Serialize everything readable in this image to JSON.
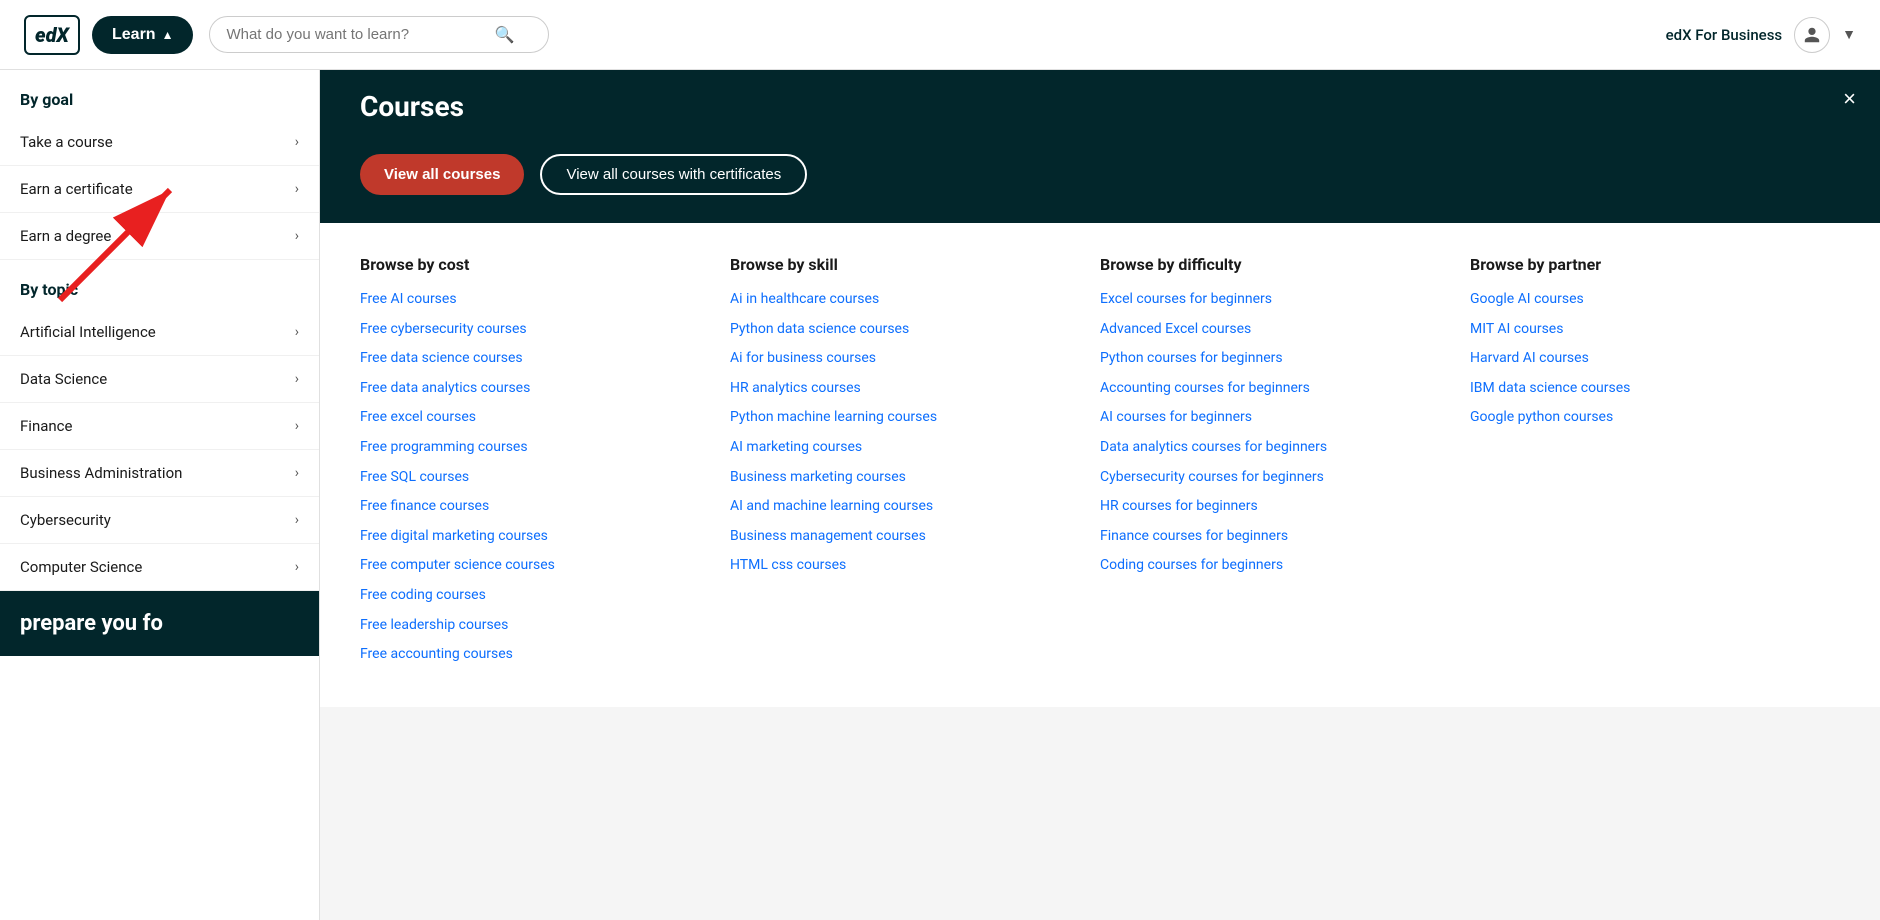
{
  "header": {
    "logo": "edX",
    "learn_button": "Learn",
    "search_placeholder": "What do you want to learn?",
    "for_business": "edX For Business"
  },
  "sidebar": {
    "by_goal_title": "By goal",
    "by_topic_title": "By topic",
    "goal_items": [
      {
        "label": "Take a course"
      },
      {
        "label": "Earn a certificate"
      },
      {
        "label": "Earn a degree"
      }
    ],
    "topic_items": [
      {
        "label": "Artificial Intelligence"
      },
      {
        "label": "Data Science"
      },
      {
        "label": "Finance"
      },
      {
        "label": "Business Administration"
      },
      {
        "label": "Cybersecurity"
      },
      {
        "label": "Computer Science"
      }
    ],
    "bottom_banner": "prepare you fo"
  },
  "dropdown": {
    "title": "Courses",
    "btn_primary": "View all courses",
    "btn_outline": "View all courses with certificates",
    "close_label": "×"
  },
  "browse": {
    "columns": [
      {
        "title": "Browse by cost",
        "links": [
          "Free AI courses",
          "Free cybersecurity courses",
          "Free data science courses",
          "Free data analytics courses",
          "Free excel courses",
          "Free programming courses",
          "Free SQL courses",
          "Free finance courses",
          "Free digital marketing courses",
          "Free computer science courses",
          "Free coding courses",
          "Free leadership courses",
          "Free accounting courses"
        ]
      },
      {
        "title": "Browse by skill",
        "links": [
          "Ai in healthcare courses",
          "Python data science courses",
          "Ai for business courses",
          "HR analytics courses",
          "Python machine learning courses",
          "AI marketing courses",
          "Business marketing courses",
          "AI and machine learning courses",
          "Business management courses",
          "HTML css courses"
        ]
      },
      {
        "title": "Browse by difficulty",
        "links": [
          "Excel courses for beginners",
          "Advanced Excel courses",
          "Python courses for beginners",
          "Accounting courses for beginners",
          "AI courses for beginners",
          "Data analytics courses for beginners",
          "Cybersecurity courses for beginners",
          "HR courses for beginners",
          "Finance courses for beginners",
          "Coding courses for beginners"
        ]
      },
      {
        "title": "Browse by partner",
        "links": [
          "Google AI courses",
          "MIT AI courses",
          "Harvard AI courses",
          "IBM data science courses",
          "Google python courses"
        ]
      }
    ]
  }
}
